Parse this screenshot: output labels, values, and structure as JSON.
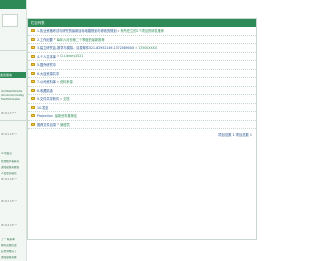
{
  "sidebar": {
    "menu_label": "发表留言",
    "blocks": [
      {
        "lines": [
          "ctorMeshStripSe",
          "ctionCommonPag",
          "FieldHoldLabel"
        ]
      },
      {
        "lines": [
          "IP:111.1**.*"
        ]
      },
      {
        "lines": [
          "IP:111.13*.*"
        ]
      },
      {
        "lines": [
          "IP:111.16*.*"
        ]
      },
      {
        "lines": [
          "IP:117.13*.*"
        ]
      },
      {
        "lines": [
          "IP:113.14*.*"
        ]
      }
    ],
    "notice_lines": [
      "ol 所发言",
      "管理帐户看看可",
      "通知提醒系统提",
      "人变更关联信"
    ],
    "notice_lines_2": [
      "了一 联系本",
      "拥有反映出现",
      "后台调整好了",
      "通知提醒系统"
    ]
  },
  "list": {
    "header": "栏目列表",
    "rows": [
      {
        "title": "1.执业资格考试与研究的最新目标电路规划与修改的规划",
        "latest": "有所任立的2个项目的研发推荐",
        "sep": "»"
      },
      {
        "title": "2.工作纪要",
        "latest": "每年六月份第二个季度的最新推荐",
        "sep": "»"
      },
      {
        "title": "3.建立研究会-数学与模拟，请发邮件021-82952149-13720890XX",
        "latest": "13500XXXX",
        "sep": "»"
      },
      {
        "title": "4.个人文本库",
        "latest": "Cl.Library2021",
        "sep": "»"
      },
      {
        "title": "5.国外研究中",
        "latest": "",
        "sep": ""
      },
      {
        "title": "6.大连资源共享",
        "latest": "",
        "sep": ""
      },
      {
        "title": "7.公司资料库",
        "latest": "资料来源",
        "sep": "»"
      },
      {
        "title": "8.收藏精选",
        "latest": "",
        "sep": ""
      },
      {
        "title": "9.文件共享软件",
        "latest": "文档",
        "sep": "»"
      },
      {
        "title": "10.发至",
        "latest": "",
        "sep": ""
      },
      {
        "title": "Projection",
        "latest": "最新资料推荐区",
        "sep": ""
      },
      {
        "title": "推荐文件目录",
        "latest": "管理员",
        "sep": "»"
      }
    ],
    "footer": "项目总数 1 项目总数 1"
  },
  "colors": {
    "accent": "#2e8b57",
    "link": "#1d4e89",
    "folder": "#f2c744"
  }
}
